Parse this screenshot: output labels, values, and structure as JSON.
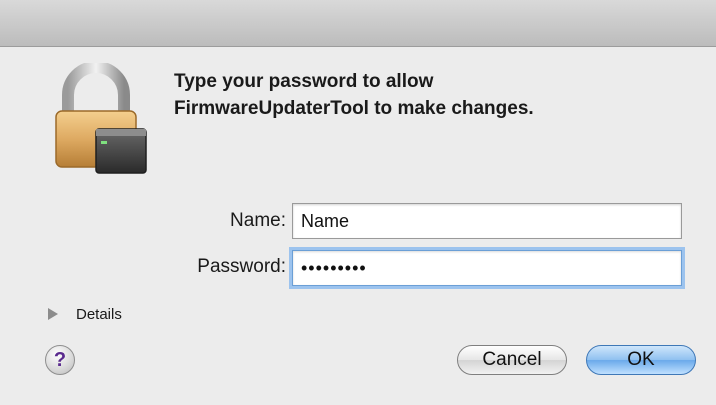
{
  "dialog": {
    "message_line1": "Type your password to allow",
    "message_line2": "FirmwareUpdaterTool to make changes.",
    "name_label": "Name:",
    "name_value": "Name",
    "password_label": "Password:",
    "password_value": "•••••••••",
    "details_label": "Details",
    "help_label": "?",
    "cancel_label": "Cancel",
    "ok_label": "OK"
  },
  "icons": {
    "lock": "lock-icon",
    "disclosure": "disclosure-triangle-icon",
    "help": "help-icon"
  },
  "colors": {
    "accent": "#6aa9ea",
    "focus_ring": "#9cc3ee",
    "lock_body": "#d9a25a"
  }
}
